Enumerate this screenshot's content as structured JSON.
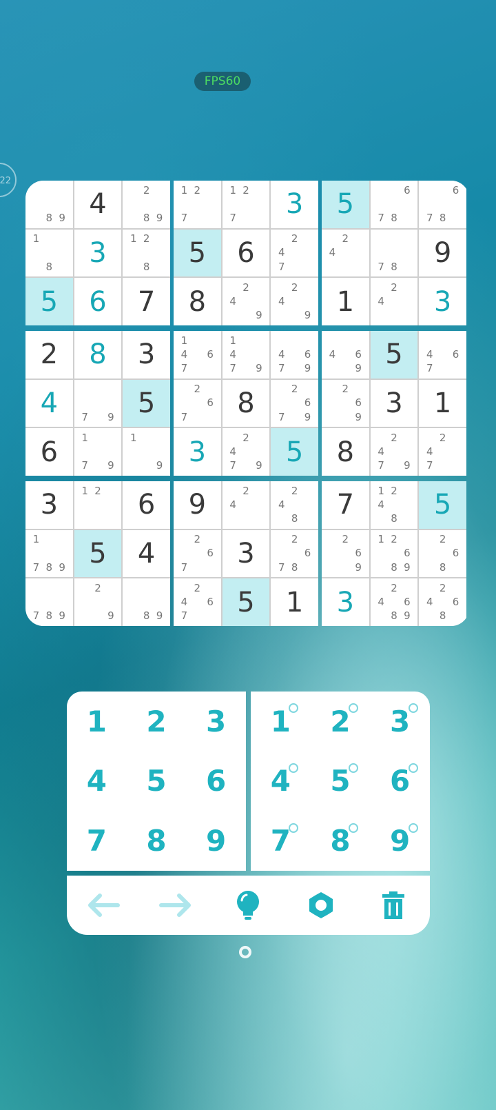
{
  "status": {
    "fps_label": "FPS60",
    "timer_label": "22"
  },
  "colors": {
    "accent": "#1fb3c0",
    "highlight": "#c3eef2",
    "given": "#3a3a3a",
    "notes": "#777777"
  },
  "board": {
    "boxes": [
      [
        {
          "n": [
            "",
            "",
            "",
            "",
            "",
            "",
            "",
            "8",
            "9"
          ]
        },
        {
          "v": "4"
        },
        {
          "n": [
            "",
            "2",
            "",
            "",
            "",
            "",
            "",
            "8",
            "9"
          ]
        },
        {
          "n": [
            "1",
            "",
            "",
            "",
            "",
            "",
            "",
            "8",
            ""
          ]
        },
        {
          "v": "3",
          "user": true
        },
        {
          "n": [
            "1",
            "2",
            "",
            "",
            "",
            "",
            "",
            "8",
            ""
          ]
        },
        {
          "v": "5",
          "user": true,
          "hl": true
        },
        {
          "v": "6",
          "user": true
        },
        {
          "v": "7"
        }
      ],
      [
        {
          "n": [
            "1",
            "2",
            "",
            "",
            "",
            "",
            "7",
            "",
            ""
          ]
        },
        {
          "n": [
            "1",
            "2",
            "",
            "",
            "",
            "",
            "7",
            "",
            ""
          ]
        },
        {
          "v": "3",
          "user": true
        },
        {
          "v": "5",
          "hl": true
        },
        {
          "v": "6"
        },
        {
          "n": [
            "",
            "2",
            "",
            "4",
            "",
            "",
            "7",
            "",
            ""
          ]
        },
        {
          "v": "8"
        },
        {
          "n": [
            "",
            "2",
            "",
            "4",
            "",
            "",
            "",
            "",
            "9"
          ]
        },
        {
          "n": [
            "",
            "2",
            "",
            "4",
            "",
            "",
            "",
            "",
            "9"
          ]
        }
      ],
      [
        {
          "v": "5",
          "user": true,
          "hl": true
        },
        {
          "n": [
            "",
            "",
            "6",
            "",
            "",
            "",
            "7",
            "8",
            ""
          ]
        },
        {
          "n": [
            "",
            "",
            "6",
            "",
            "",
            "",
            "7",
            "8",
            ""
          ]
        },
        {
          "n": [
            "",
            "2",
            "",
            "4",
            "",
            "",
            "",
            "",
            ""
          ]
        },
        {
          "n": [
            "",
            "",
            "",
            "",
            "",
            "",
            "7",
            "8",
            ""
          ]
        },
        {
          "v": "9"
        },
        {
          "v": "1"
        },
        {
          "n": [
            "",
            "2",
            "",
            "4",
            "",
            "",
            "",
            "",
            ""
          ]
        },
        {
          "v": "3",
          "user": true
        }
      ],
      [
        {
          "v": "2"
        },
        {
          "v": "8",
          "user": true
        },
        {
          "v": "3"
        },
        {
          "v": "4",
          "user": true
        },
        {
          "n": [
            "",
            "",
            "",
            "",
            "",
            "",
            "7",
            "",
            "9"
          ]
        },
        {
          "v": "5",
          "hl": true
        },
        {
          "v": "6"
        },
        {
          "n": [
            "1",
            "",
            "",
            "",
            "",
            "",
            "7",
            "",
            "9"
          ]
        },
        {
          "n": [
            "1",
            "",
            "",
            "",
            "",
            "",
            "",
            "",
            "9"
          ]
        }
      ],
      [
        {
          "n": [
            "1",
            "",
            "",
            "4",
            "",
            "6",
            "7",
            "",
            ""
          ]
        },
        {
          "n": [
            "1",
            "",
            "",
            "4",
            "",
            "",
            "7",
            "",
            "9"
          ]
        },
        {
          "n": [
            "",
            "",
            "",
            "4",
            "",
            "6",
            "7",
            "",
            "9"
          ]
        },
        {
          "n": [
            "",
            "2",
            "",
            "",
            "",
            "6",
            "7",
            "",
            ""
          ]
        },
        {
          "v": "8"
        },
        {
          "n": [
            "",
            "2",
            "",
            "",
            "",
            "6",
            "7",
            "",
            "9"
          ]
        },
        {
          "v": "3",
          "user": true
        },
        {
          "n": [
            "",
            "2",
            "",
            "4",
            "",
            "",
            "7",
            "",
            "9"
          ]
        },
        {
          "v": "5",
          "user": true,
          "hl": true
        }
      ],
      [
        {
          "n": [
            "",
            "",
            "",
            "4",
            "",
            "6",
            "",
            "",
            "9"
          ]
        },
        {
          "v": "5",
          "hl": true
        },
        {
          "n": [
            "",
            "",
            "",
            "4",
            "",
            "6",
            "7",
            "",
            ""
          ]
        },
        {
          "n": [
            "",
            "2",
            "",
            "",
            "",
            "6",
            "",
            "",
            "9"
          ]
        },
        {
          "v": "3"
        },
        {
          "v": "1"
        },
        {
          "v": "8"
        },
        {
          "n": [
            "",
            "2",
            "",
            "4",
            "",
            "",
            "7",
            "",
            "9"
          ]
        },
        {
          "n": [
            "",
            "2",
            "",
            "4",
            "",
            "",
            "7",
            "",
            ""
          ]
        }
      ],
      [
        {
          "v": "3"
        },
        {
          "n": [
            "1",
            "2",
            "",
            "",
            "",
            "",
            "",
            "",
            ""
          ]
        },
        {
          "v": "6"
        },
        {
          "n": [
            "1",
            "",
            "",
            "",
            "",
            "",
            "7",
            "8",
            "9"
          ]
        },
        {
          "v": "5",
          "hl": true
        },
        {
          "v": "4"
        },
        {
          "n": [
            "",
            "",
            "",
            "",
            "",
            "",
            "7",
            "8",
            "9"
          ]
        },
        {
          "n": [
            "",
            "2",
            "",
            "",
            "",
            "",
            "",
            "",
            "9"
          ]
        },
        {
          "n": [
            "",
            "",
            "",
            "",
            "",
            "",
            "",
            "8",
            "9"
          ]
        }
      ],
      [
        {
          "v": "9"
        },
        {
          "n": [
            "",
            "2",
            "",
            "4",
            "",
            "",
            "",
            "",
            ""
          ]
        },
        {
          "n": [
            "",
            "2",
            "",
            "4",
            "",
            "",
            "",
            "8",
            ""
          ]
        },
        {
          "n": [
            "",
            "2",
            "",
            "",
            "",
            "6",
            "7",
            "",
            ""
          ]
        },
        {
          "v": "3"
        },
        {
          "n": [
            "",
            "2",
            "",
            "",
            "",
            "6",
            "7",
            "8",
            ""
          ]
        },
        {
          "n": [
            "",
            "2",
            "",
            "4",
            "",
            "6",
            "7",
            "",
            ""
          ]
        },
        {
          "v": "5",
          "hl": true
        },
        {
          "v": "1"
        }
      ],
      [
        {
          "v": "7"
        },
        {
          "n": [
            "1",
            "2",
            "",
            "4",
            "",
            "",
            "",
            "8",
            ""
          ]
        },
        {
          "v": "5",
          "user": true,
          "hl": true
        },
        {
          "n": [
            "",
            "2",
            "",
            "",
            "",
            "6",
            "",
            "",
            "9"
          ]
        },
        {
          "n": [
            "1",
            "2",
            "",
            "",
            "",
            "6",
            "",
            "8",
            "9"
          ]
        },
        {
          "n": [
            "",
            "2",
            "",
            "",
            "",
            "6",
            "",
            "8",
            ""
          ]
        },
        {
          "v": "3",
          "user": true
        },
        {
          "n": [
            "",
            "2",
            "",
            "4",
            "",
            "6",
            "",
            "8",
            "9"
          ]
        },
        {
          "n": [
            "",
            "2",
            "",
            "4",
            "",
            "6",
            "",
            "8",
            ""
          ]
        }
      ]
    ]
  },
  "pad": {
    "digits": [
      "1",
      "2",
      "3",
      "4",
      "5",
      "6",
      "7",
      "8",
      "9"
    ],
    "notes_mode_digits": [
      "1",
      "2",
      "3",
      "4",
      "5",
      "6",
      "7",
      "8",
      "9"
    ]
  },
  "toolbar": {
    "icons": [
      "undo-arrow-icon",
      "redo-arrow-icon",
      "hint-bulb-icon",
      "settings-gear-icon",
      "trash-icon"
    ]
  }
}
